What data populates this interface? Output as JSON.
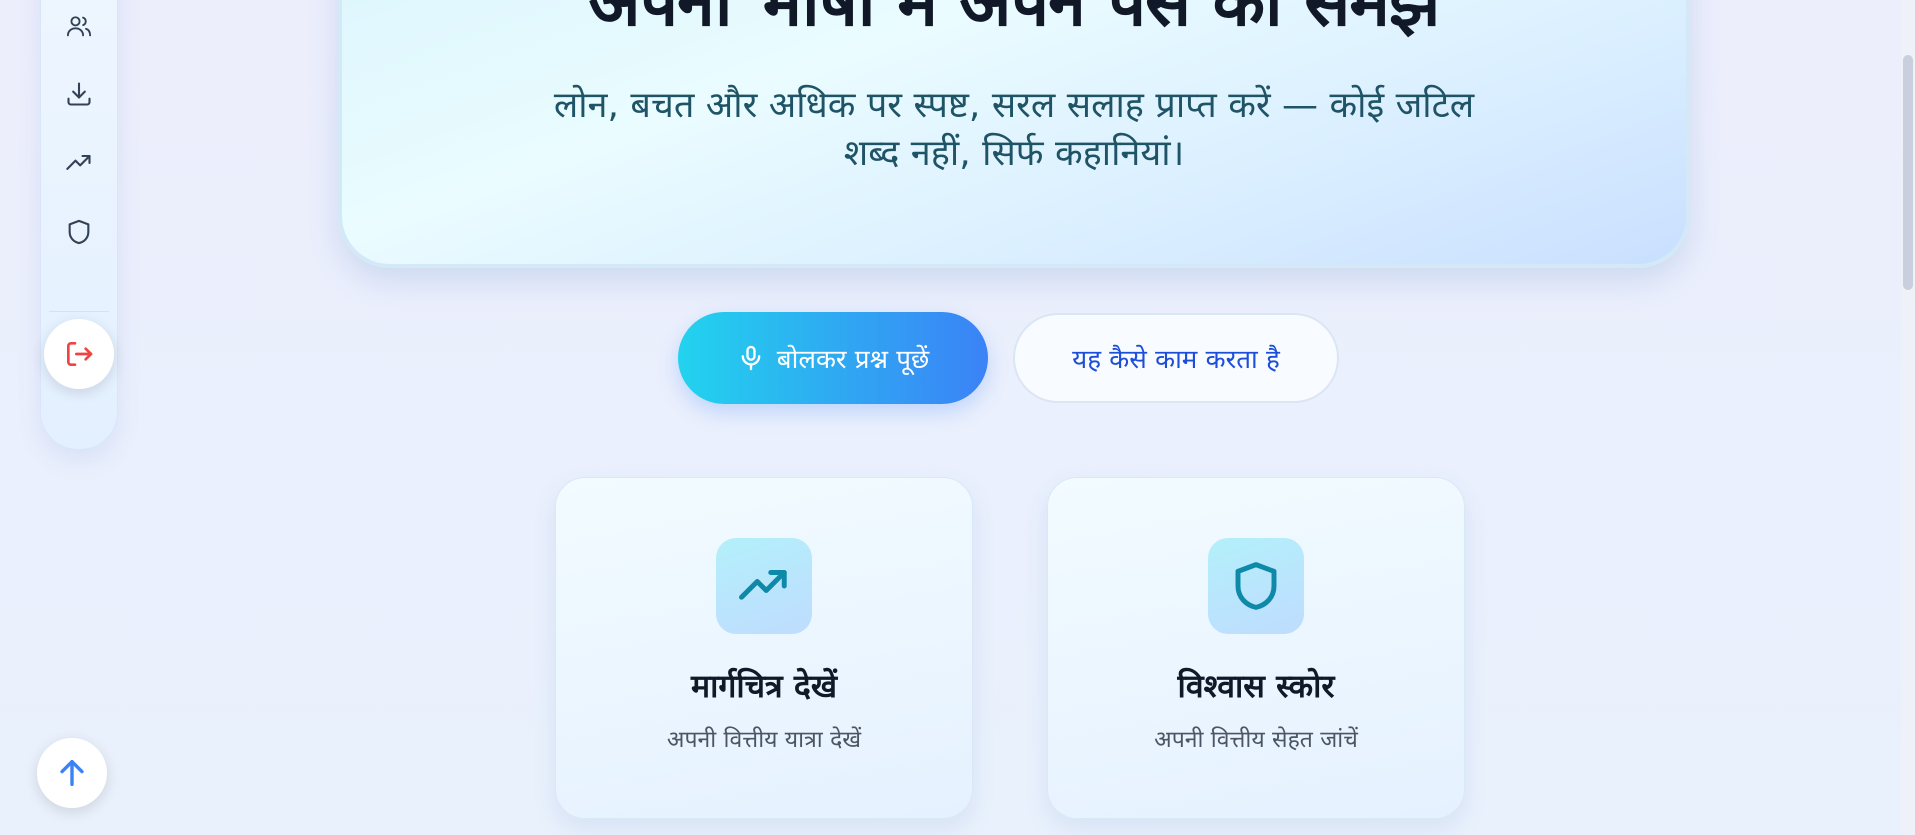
{
  "sidebar": {
    "items": [
      {
        "icon": "users-icon",
        "name": "sidebar-item-users"
      },
      {
        "icon": "download-icon",
        "name": "sidebar-item-download"
      },
      {
        "icon": "trending-up-icon",
        "name": "sidebar-item-roadmap"
      },
      {
        "icon": "shield-icon",
        "name": "sidebar-item-trust"
      }
    ],
    "logout_icon": "logout-icon"
  },
  "hero": {
    "title": "अपनी भाषा में अपने पैसे को समझें",
    "subtitle": "लोन, बचत और अधिक पर स्पष्ट, सरल सलाह प्राप्त करें — कोई जटिल शब्द नहीं, सिर्फ कहानियां।"
  },
  "actions": {
    "ask_label": "बोलकर प्रश्न पूछें",
    "how_label": "यह कैसे काम करता है"
  },
  "cards": [
    {
      "title": "मार्गचित्र देखें",
      "desc": "अपनी वित्तीय यात्रा देखें",
      "icon": "trending-up-icon"
    },
    {
      "title": "विश्वास स्कोर",
      "desc": "अपनी वित्तीय सेहत जांचें",
      "icon": "shield-icon"
    }
  ],
  "colors": {
    "accent_start": "#22d3ee",
    "accent_end": "#3b82f6",
    "icon_teal": "#0e8aa8",
    "logout_red": "#ef4444",
    "link_blue": "#1d4ed8"
  }
}
